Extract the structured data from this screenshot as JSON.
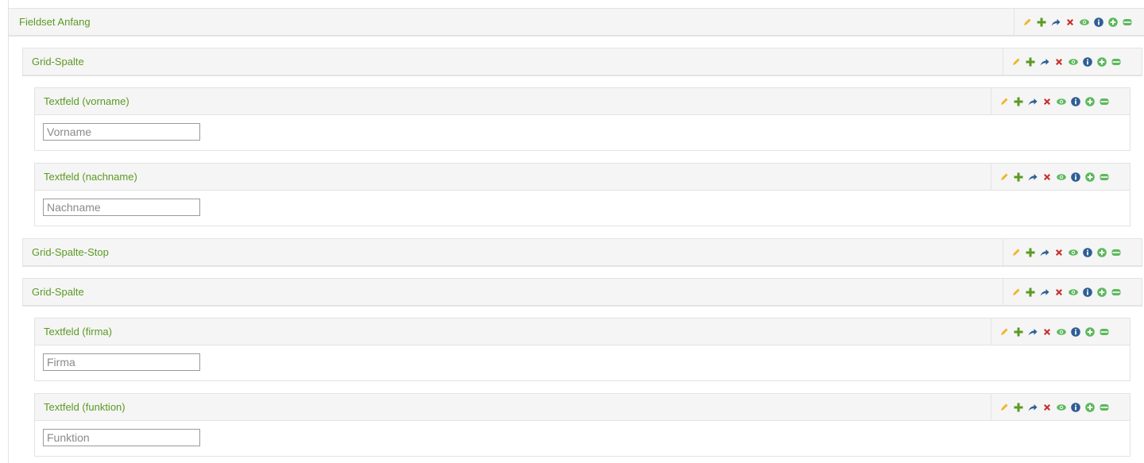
{
  "colors": {
    "title": "#5b9a22",
    "edit": "#f0b429",
    "add": "#5b9a22",
    "move": "#2f5e95",
    "delete": "#c9302c",
    "view": "#5cb85c",
    "info": "#2f5e95",
    "plus_circle": "#5cb85c",
    "minus": "#5cb85c"
  },
  "toolbar_icons": [
    "pencil-icon",
    "plus-icon",
    "share-arrow-icon",
    "close-icon",
    "eye-icon",
    "info-icon",
    "plus-circle-icon",
    "minus-icon"
  ],
  "elements": {
    "fieldset_start": {
      "title": "Fieldset Anfang"
    },
    "grid_column_1": {
      "title": "Grid-Spalte"
    },
    "textfield_vorname": {
      "title": "Textfeld (vorname)",
      "placeholder": "Vorname",
      "value": ""
    },
    "textfield_nachname": {
      "title": "Textfeld (nachname)",
      "placeholder": "Nachname",
      "value": ""
    },
    "grid_column_stop": {
      "title": "Grid-Spalte-Stop"
    },
    "grid_column_2": {
      "title": "Grid-Spalte"
    },
    "textfield_firma": {
      "title": "Textfeld (firma)",
      "placeholder": "Firma",
      "value": ""
    },
    "textfield_funktion": {
      "title": "Textfeld (funktion)",
      "placeholder": "Funktion",
      "value": ""
    }
  }
}
